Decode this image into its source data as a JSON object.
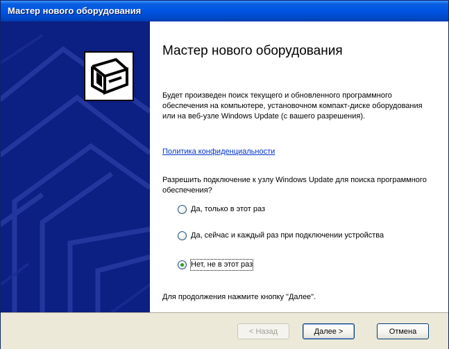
{
  "window": {
    "title": "Мастер нового оборудования"
  },
  "side_panel": {
    "icon": "hardware-device-icon"
  },
  "content": {
    "heading": "Мастер нового оборудования",
    "description": "Будет произведен поиск текущего и обновленного программного обеспечения на компьютере, установочном компакт-диске оборудования или на веб-узле Windows Update (с вашего разрешения).",
    "privacy_link": "Политика конфиденциальности",
    "question": "Разрешить подключение к узлу Windows Update для поиска программного обеспечения?",
    "options": [
      {
        "label": "Да, только в этот раз",
        "checked": false
      },
      {
        "label": "Да, сейчас и каждый раз при подключении устройства",
        "checked": false
      },
      {
        "label": "Нет, не в этот раз",
        "checked": true
      }
    ],
    "footer_note": "Для продолжения нажмите кнопку \"Далее\"."
  },
  "buttons": {
    "back": "< Назад",
    "next": "Далее >",
    "cancel": "Отмена"
  },
  "colors": {
    "titlebar": "#0054e3",
    "side_panel": "#0c1f82",
    "button_bar": "#ece9d8",
    "link": "#0033cc",
    "radio_dot": "#21a121"
  }
}
